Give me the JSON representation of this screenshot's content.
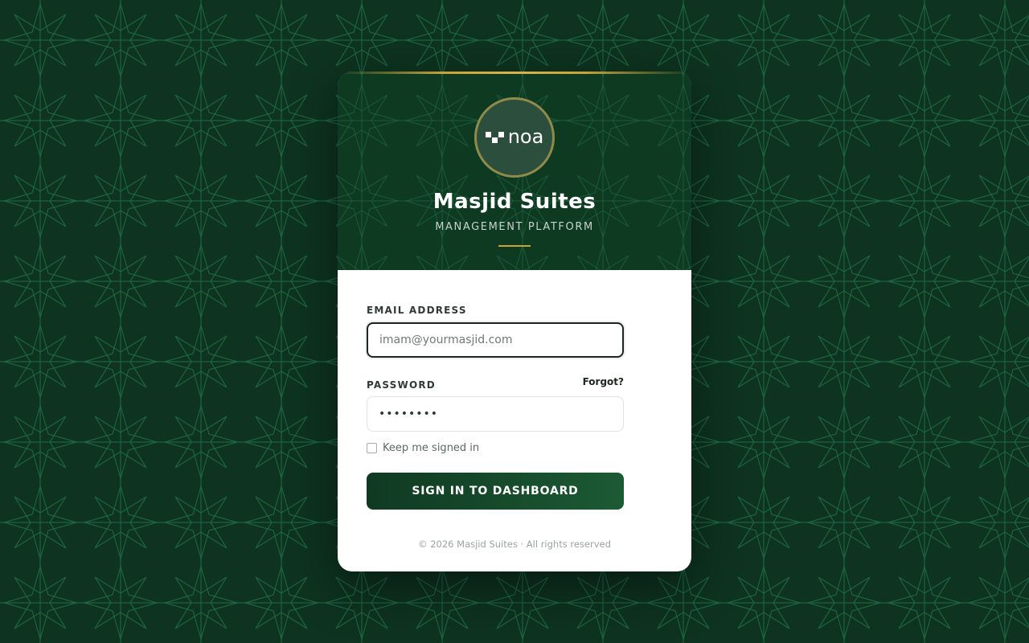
{
  "brand": {
    "logo_text": "noa",
    "title": "Masjid Suites",
    "subtitle": "MANAGEMENT PLATFORM"
  },
  "form": {
    "email_label": "EMAIL ADDRESS",
    "email_placeholder": "imam@yourmasjid.com",
    "email_value": "",
    "password_label": "PASSWORD",
    "forgot_label": "Forgot?",
    "password_value": "••••••••",
    "remember_label": "Keep me signed in",
    "remember_checked": false,
    "submit_label": "SIGN IN TO DASHBOARD"
  },
  "footer": {
    "copyright": "© 2026 Masjid Suites · All rights reserved"
  },
  "colors": {
    "background": "#0e3320",
    "pattern_stroke": "#1f6a45",
    "header_bg": "#0f3a22",
    "accent_gold": "#c9a23a",
    "button_start": "#0f3a22",
    "button_end": "#1c5a34"
  },
  "icons": {
    "logo_mark": "pixel-blocks-logo-icon",
    "background_motif": "eight-point-star-pattern"
  }
}
